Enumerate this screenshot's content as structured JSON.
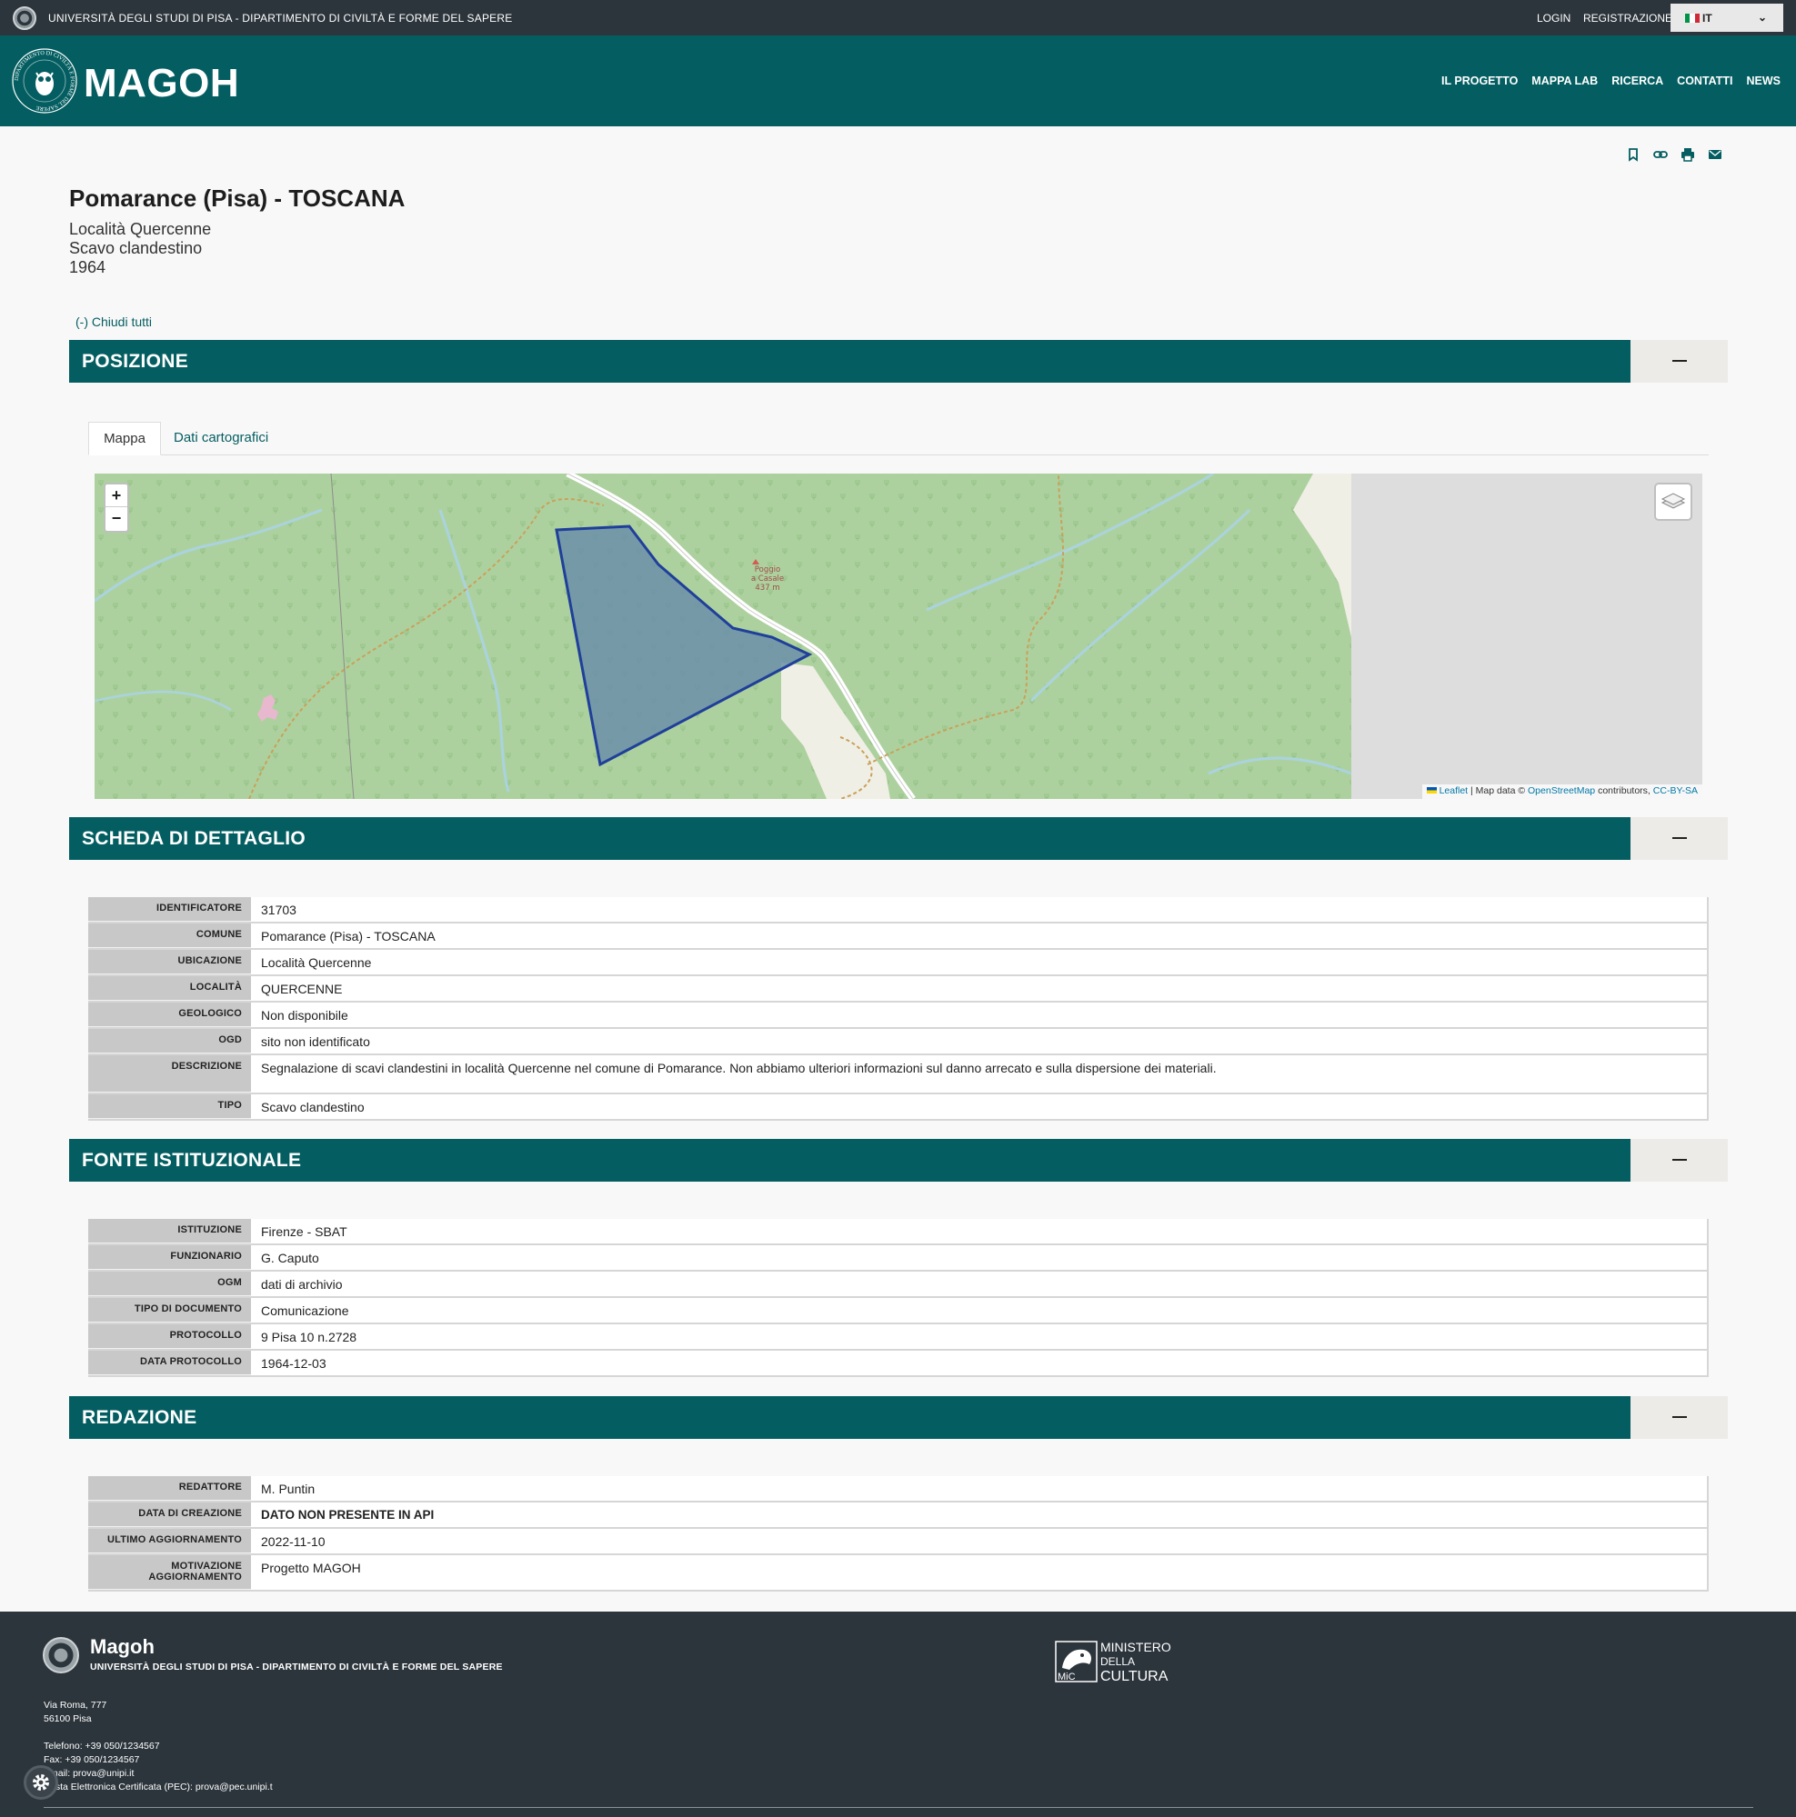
{
  "topbar": {
    "university": "UNIVERSITÀ DEGLI STUDI DI PISA - DIPARTIMENTO DI CIVILTÀ E FORME DEL SAPERE",
    "login": "LOGIN",
    "register": "REGISTRAZIONE",
    "language": "IT"
  },
  "header": {
    "brand": "MAGOH",
    "seal_text": "DIPARTIMENTO DI CIVILTÀ E FORME DEL SAPERE",
    "nav": [
      "IL PROGETTO",
      "MAPPA LAB",
      "RICERCA",
      "CONTATTI",
      "NEWS"
    ]
  },
  "record": {
    "title": "Pomarance (Pisa) - TOSCANA",
    "location": "Località Quercenne",
    "type": "Scavo clandestino",
    "year": "1964"
  },
  "close_all": "(-) Chiudi tutti",
  "sections": {
    "posizione": "POSIZIONE",
    "scheda": "SCHEDA DI DETTAGLIO",
    "fonte": "FONTE ISTITUZIONALE",
    "redazione": "REDAZIONE"
  },
  "tabs": [
    "Mappa",
    "Dati cartografici"
  ],
  "map": {
    "zoom_in": "+",
    "zoom_out": "−",
    "peak_name_1": "Poggio",
    "peak_name_2": "a Casale",
    "peak_elevation": "437 m",
    "attribution_leaflet": "Leaflet",
    "attribution_text_1": " | Map data © ",
    "attribution_osm": "OpenStreetMap",
    "attribution_text_2": " contributors, ",
    "attribution_license": "CC-BY-SA",
    "colors": {
      "forest": "#add19e",
      "polygon_fill": "#6b8fa8",
      "polygon_stroke": "#1f3f9a",
      "bare": "#f0efe6",
      "blank": "#dddddd"
    }
  },
  "scheda": [
    {
      "label": "IDENTIFICATORE",
      "value": "31703"
    },
    {
      "label": "COMUNE",
      "value": "Pomarance (Pisa) - TOSCANA"
    },
    {
      "label": "UBICAZIONE",
      "value": "Località Quercenne"
    },
    {
      "label": "LOCALITÀ",
      "value": "QUERCENNE"
    },
    {
      "label": "GEOLOGICO",
      "value": "Non disponibile"
    },
    {
      "label": "OGD",
      "value": "sito non identificato"
    },
    {
      "label": "DESCRIZIONE",
      "value": "Segnalazione di scavi clandestini in località Quercenne nel comune di Pomarance. Non abbiamo ulteriori informazioni sul danno arrecato e sulla dispersione dei materiali."
    },
    {
      "label": "TIPO",
      "value": "Scavo clandestino"
    }
  ],
  "fonte": [
    {
      "label": "ISTITUZIONE",
      "value": "Firenze - SBAT"
    },
    {
      "label": "FUNZIONARIO",
      "value": "G. Caputo"
    },
    {
      "label": "OGM",
      "value": "dati di archivio"
    },
    {
      "label": "TIPO DI DOCUMENTO",
      "value": "Comunicazione"
    },
    {
      "label": "PROTOCOLLO",
      "value": "9 Pisa 10 n.2728"
    },
    {
      "label": "DATA PROTOCOLLO",
      "value": "1964-12-03"
    }
  ],
  "redazione": [
    {
      "label": "REDATTORE",
      "value": "M. Puntin"
    },
    {
      "label": "DATA DI CREAZIONE",
      "value": "DATO NON PRESENTE IN API"
    },
    {
      "label": "ULTIMO AGGIORNAMENTO",
      "value": "2022-11-10"
    },
    {
      "label": "MOTIVAZIONE AGGIORNAMENTO",
      "value": "Progetto MAGOH"
    }
  ],
  "footer": {
    "name": "Magoh",
    "university": "UNIVERSITÀ DEGLI STUDI DI PISA - DIPARTIMENTO DI CIVILTÀ E FORME DEL SAPERE",
    "address_1": "Via Roma, 777",
    "address_2": "56100 Pisa",
    "phone": "Telefono: +39 050/1234567",
    "fax": "Fax: +39 050/1234567",
    "email": "Email: prova@unipi.it",
    "pec": "Posta Elettronica Certificata (PEC): prova@pec.unipi.t",
    "ministry_1": "MINISTERO",
    "ministry_2": "DELLA",
    "ministry_3": "CULTURA",
    "ministry_abbr": "MiC"
  },
  "colors": {
    "primary": "#045e61",
    "dark": "#2c353c",
    "toggle_bg": "#ecebe7",
    "label_bg": "#c8c8c8"
  }
}
